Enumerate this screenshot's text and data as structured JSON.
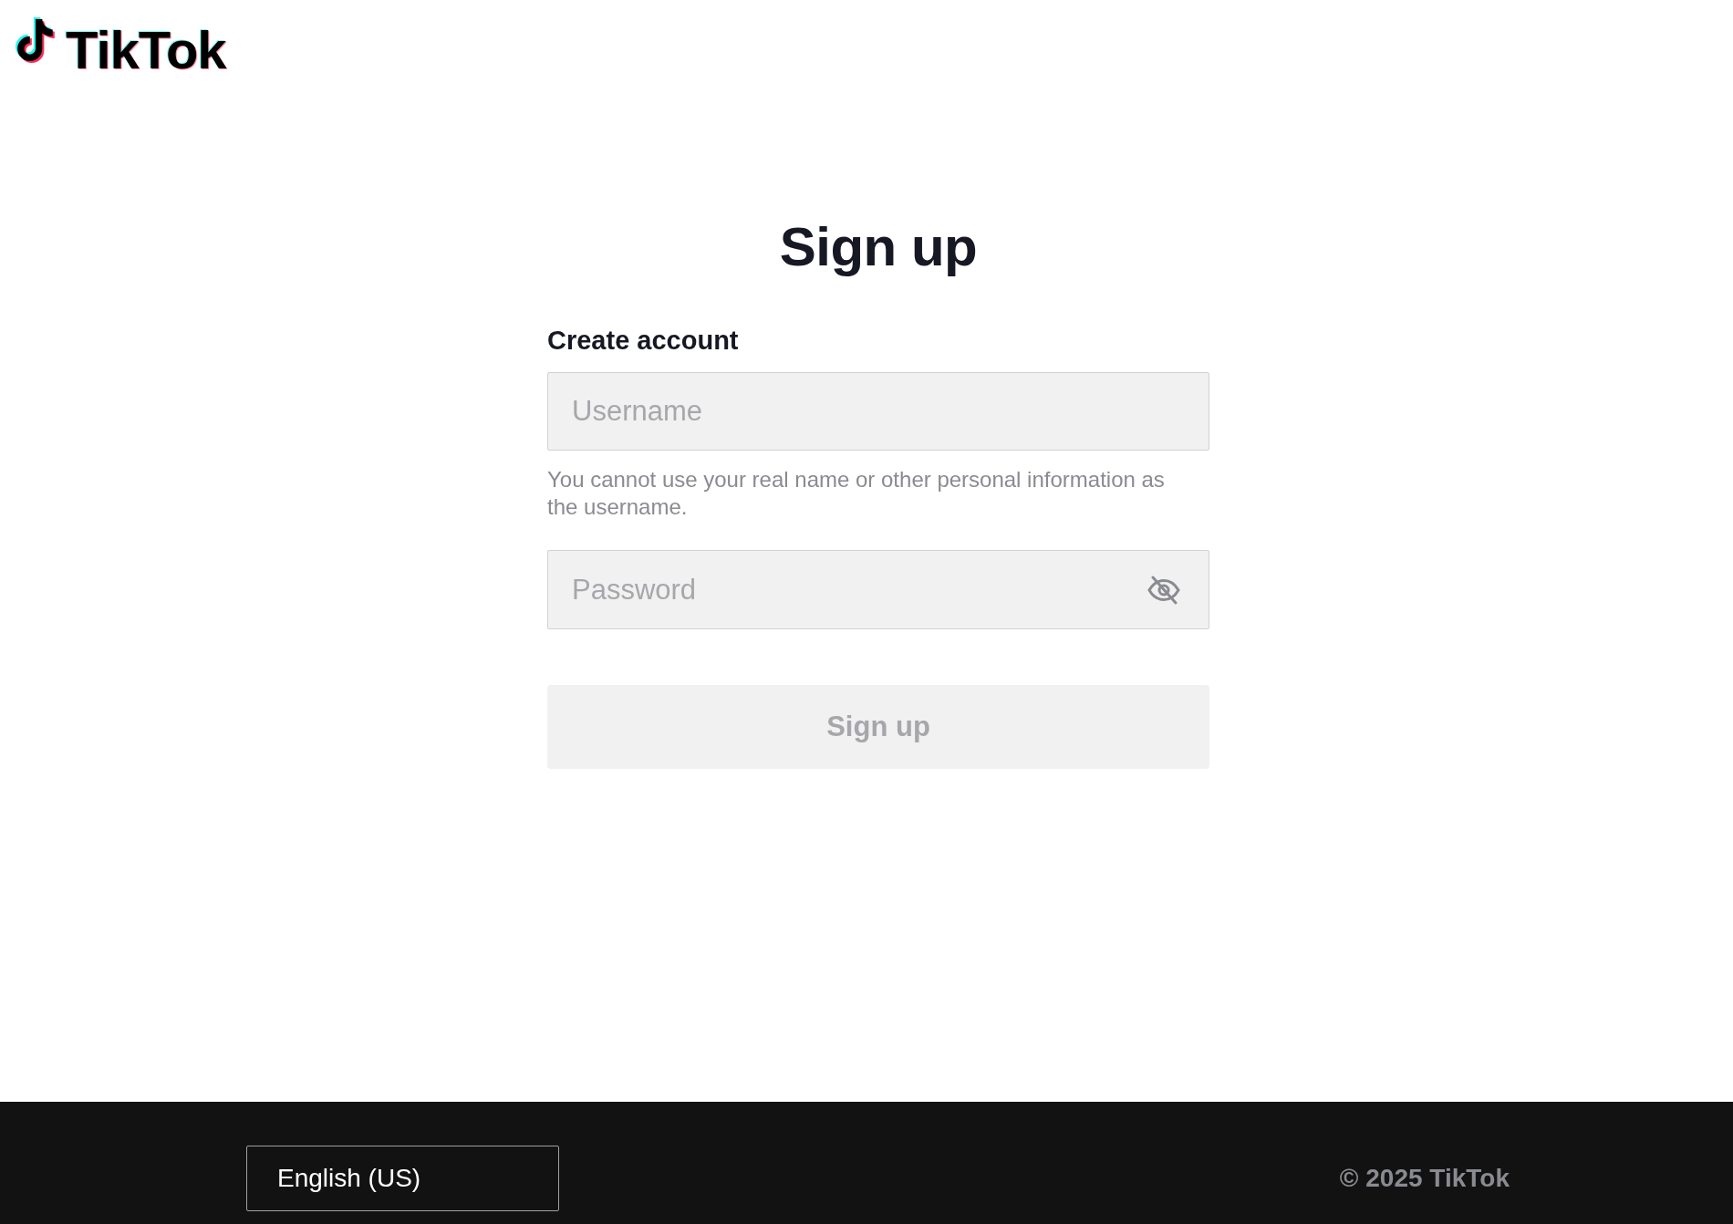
{
  "header": {
    "logo_text": "TikTok"
  },
  "form": {
    "title": "Sign up",
    "section_label": "Create account",
    "username": {
      "placeholder": "Username",
      "hint": "You cannot use your real name or other personal information as the username."
    },
    "password": {
      "placeholder": "Password",
      "visible": false
    },
    "submit": {
      "label": "Sign up",
      "disabled": true
    }
  },
  "footer": {
    "language": "English (US)",
    "copyright": "© 2025 TikTok"
  }
}
